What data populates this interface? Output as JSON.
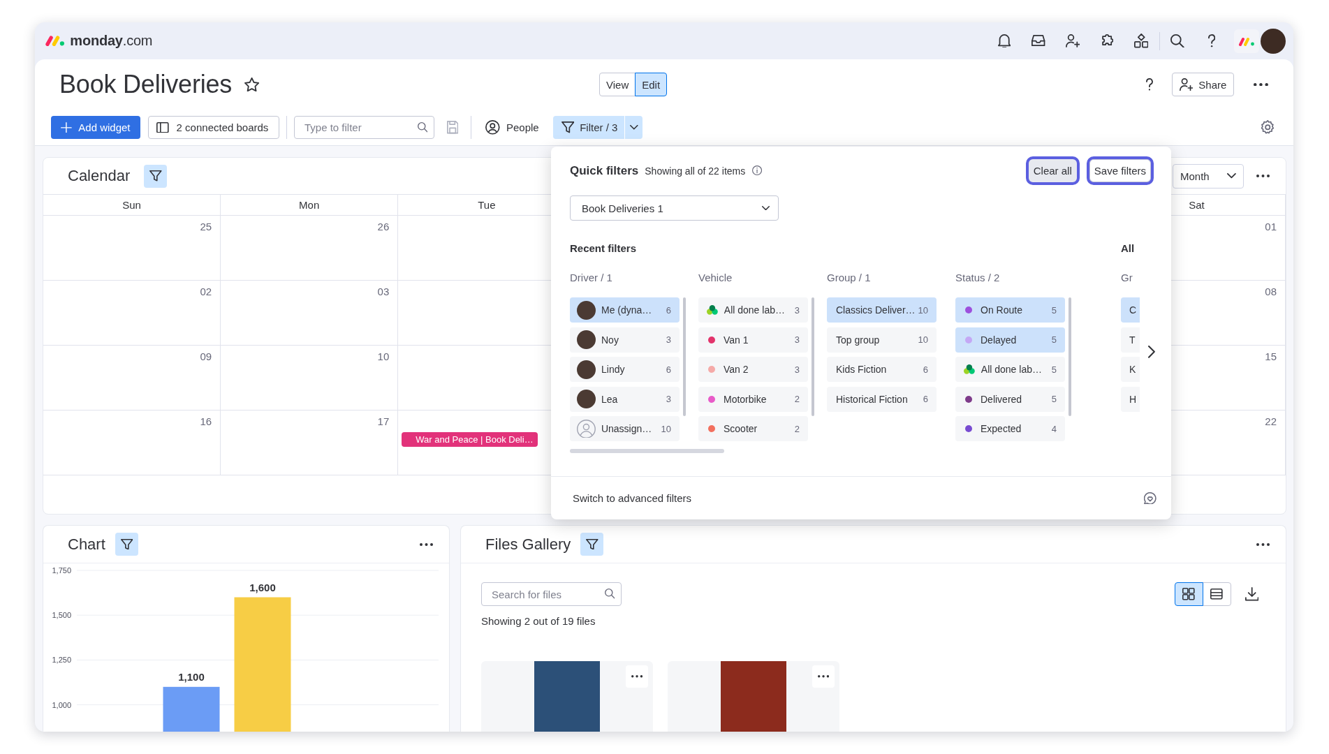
{
  "top_bar": {
    "logo_text": "**monday**.com"
  },
  "board_header": {
    "title": "Book Deliveries",
    "mode_toggle": [
      {
        "label": "View",
        "selected": false
      },
      {
        "label": "Edit",
        "selected": true
      }
    ],
    "share_button": {
      "label": "Share"
    }
  },
  "toolbar": {
    "add_widget": {
      "label": "Add widget"
    },
    "connected_boards": {
      "label": "2 connected boards"
    },
    "search": {
      "placeholder": "Type to filter"
    },
    "people": {
      "label": "People"
    },
    "filter": {
      "label": "Filter / 3",
      "active": true
    }
  },
  "calendar": {
    "title": "Calendar",
    "filter_active": true,
    "view_select": {
      "value": "Month"
    },
    "weekdays": {
      "start": [
        "Sun",
        "Mon",
        "Tue"
      ],
      "end": [
        "Sat"
      ]
    },
    "weeks": [
      {
        "start": [
          {
            "date": "25"
          },
          {
            "date": "26"
          }
        ],
        "end": [
          {
            "date": "01"
          }
        ]
      },
      {
        "start": [
          {
            "date": "02"
          },
          {
            "date": "03"
          }
        ],
        "end": [
          {
            "date": "08"
          }
        ]
      },
      {
        "start": [
          {
            "date": "09"
          },
          {
            "date": "10"
          }
        ],
        "end": [
          {
            "date": "15"
          }
        ]
      },
      {
        "start": [
          {
            "date": "16"
          },
          {
            "date": "17"
          },
          {
            "events": [
              {
                "title": "War and Peace | Book Deli…",
                "color": "#e2327a"
              }
            ]
          }
        ],
        "end": [
          {
            "date": "22"
          }
        ]
      }
    ]
  },
  "quick_filters": {
    "title": "Quick filters",
    "summary": "Showing all of 22 items",
    "buttons": [
      {
        "label": "Clear all",
        "kind": "secondary",
        "focused": true
      },
      {
        "label": "Save filters",
        "kind": "outline",
        "focused": true
      }
    ],
    "board_select": {
      "value": "Book Deliveries 1"
    },
    "sections": [
      {
        "title": "Recent filters",
        "columns": [
          {
            "header": "Driver / 1",
            "items": [
              {
                "kind": "person",
                "label": "Me (dyna…",
                "count": "6",
                "selected": true
              },
              {
                "kind": "person",
                "label": "Noy",
                "count": "3",
                "selected": false
              },
              {
                "kind": "person",
                "label": "Lindy",
                "count": "6",
                "selected": false
              },
              {
                "kind": "person",
                "label": "Lea",
                "count": "3",
                "selected": false
              },
              {
                "kind": "unassigned",
                "label": "Unassign…",
                "count": "10",
                "selected": false
              }
            ]
          },
          {
            "header": "Vehicle",
            "items": [
              {
                "kind": "cluster",
                "label": "All done lab…",
                "count": "3",
                "selected": false
              },
              {
                "kind": "dot",
                "label": "Van 1",
                "count": "3",
                "selected": false,
                "color": "#e2336b"
              },
              {
                "kind": "dot",
                "label": "Van 2",
                "count": "3",
                "selected": false,
                "color": "#f5aaa8"
              },
              {
                "kind": "dot",
                "label": "Motorbike",
                "count": "2",
                "selected": false,
                "color": "#e85bc8"
              },
              {
                "kind": "dot",
                "label": "Scooter",
                "count": "2",
                "selected": false,
                "color": "#f26f5e"
              }
            ]
          },
          {
            "header": "Group / 1",
            "items": [
              {
                "kind": "text",
                "label": "Classics Deliver…",
                "count": "10",
                "selected": true
              },
              {
                "kind": "text",
                "label": "Top group",
                "count": "10",
                "selected": false
              },
              {
                "kind": "text",
                "label": "Kids Fiction",
                "count": "6",
                "selected": false
              },
              {
                "kind": "text",
                "label": "Historical Fiction",
                "count": "6",
                "selected": false
              }
            ]
          },
          {
            "header": "Status / 2",
            "items": [
              {
                "kind": "dot",
                "label": "On Route",
                "count": "5",
                "selected": true,
                "color": "#9d50dd"
              },
              {
                "kind": "dot",
                "label": "Delayed",
                "count": "5",
                "selected": true,
                "color": "#c4a8f5"
              },
              {
                "kind": "cluster",
                "label": "All done lab…",
                "count": "5",
                "selected": false
              },
              {
                "kind": "dot",
                "label": "Delivered",
                "count": "5",
                "selected": false,
                "color": "#7e3b8a"
              },
              {
                "kind": "dot",
                "label": "Expected",
                "count": "4",
                "selected": false,
                "color": "#784bd1"
              }
            ]
          }
        ]
      },
      {
        "title": "All",
        "columns": [
          {
            "header": "Gr",
            "items": [
              {
                "kind": "text",
                "label": "C",
                "selected": true
              },
              {
                "kind": "text",
                "label": "T",
                "selected": false
              },
              {
                "kind": "text",
                "label": "K",
                "selected": false
              },
              {
                "kind": "text",
                "label": "H",
                "selected": false
              }
            ]
          }
        ]
      }
    ],
    "footer": {
      "label": "Switch to advanced filters"
    }
  },
  "chart_widget": {
    "title": "Chart",
    "filter_active": true,
    "chart_data": {
      "type": "bar",
      "series": [
        {
          "color": "#6b9cf5",
          "values": [
            1100
          ]
        },
        {
          "color": "#f7cd45",
          "values": [
            1600
          ]
        }
      ],
      "ylim": [
        850,
        1750
      ],
      "yticks": [
        {
          "value": 1000,
          "label": "1,000"
        },
        {
          "value": 1250,
          "label": "1,250"
        },
        {
          "value": 1500,
          "label": "1,500"
        },
        {
          "value": 1750,
          "label": "1,750"
        }
      ],
      "grid": true,
      "value_labels": [
        "1,100",
        "1,600"
      ]
    }
  },
  "files_widget": {
    "title": "Files Gallery",
    "filter_active": true,
    "search": {
      "placeholder": "Search for files"
    },
    "summary": "Showing 2 out of 19 files",
    "views": [
      {
        "kind": "grid",
        "selected": true
      },
      {
        "kind": "list",
        "selected": false
      }
    ],
    "files": [
      {
        "color": "#2c5078"
      },
      {
        "color": "#8c2b1d"
      }
    ]
  }
}
